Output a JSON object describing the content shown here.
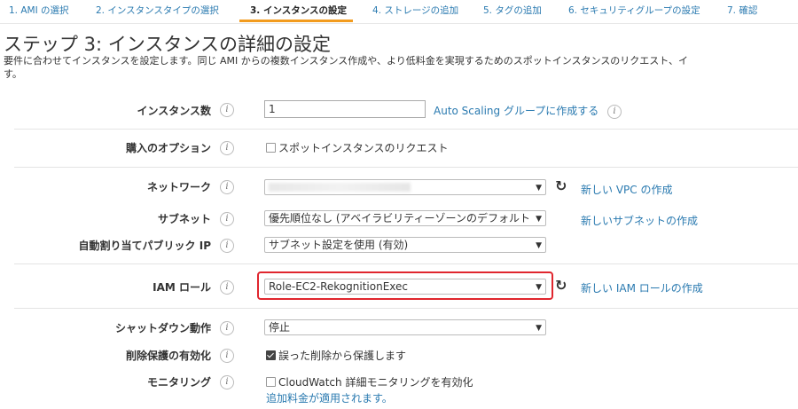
{
  "tabs": [
    {
      "label": "1. AMI の選択"
    },
    {
      "label": "2. インスタンスタイプの選択"
    },
    {
      "label": "3. インスタンスの設定"
    },
    {
      "label": "4. ストレージの追加"
    },
    {
      "label": "5. タグの追加"
    },
    {
      "label": "6. セキュリティグループの設定"
    },
    {
      "label": "7. 確認"
    }
  ],
  "page": {
    "title": "ステップ 3: インスタンスの詳細の設定",
    "description_line1": "要件に合わせてインスタンスを設定します。同じ AMI からの複数インスタンス作成や、より低料金を実現するためのスポットインスタンスのリクエスト、イ",
    "description_line2": "す。"
  },
  "info_icon": "i",
  "accent_color": "#f29b1e",
  "highlight_color": "#e0262e",
  "form": {
    "instance_count": {
      "label": "インスタンス数",
      "value": "1",
      "link": "Auto Scaling グループに作成する"
    },
    "purchase_option": {
      "label": "購入のオプション",
      "checkbox": "スポットインスタンスのリクエスト",
      "checked": false
    },
    "network": {
      "label": "ネットワーク",
      "link": "新しい VPC の作成"
    },
    "subnet": {
      "label": "サブネット",
      "value": "優先順位なし (アベイラビリティーゾーンのデフォルト)",
      "link": "新しいサブネットの作成"
    },
    "public_ip": {
      "label": "自動割り当てパブリック IP",
      "value": "サブネット設定を使用 (有効)"
    },
    "iam_role": {
      "label": "IAM ロール",
      "value": "Role-EC2-RekognitionExec",
      "link": "新しい IAM ロールの作成"
    },
    "shutdown": {
      "label": "シャットダウン動作",
      "value": "停止"
    },
    "termination_protection": {
      "label": "削除保護の有効化",
      "checkbox": "誤った削除から保護します",
      "checked": true
    },
    "monitoring": {
      "label": "モニタリング",
      "checkbox": "CloudWatch 詳細モニタリングを有効化",
      "checked": false,
      "note_link": "追加料金が適用されます。"
    }
  }
}
